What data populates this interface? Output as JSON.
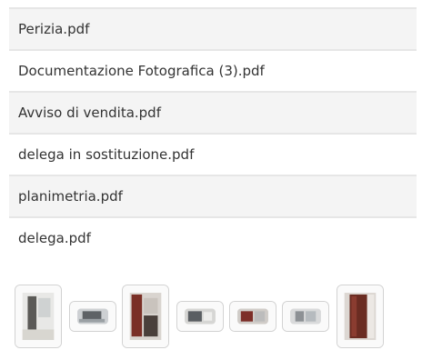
{
  "documents": [
    {
      "label": "Perizia.pdf"
    },
    {
      "label": "Documentazione Fotografica (3).pdf"
    },
    {
      "label": "Avviso di vendita.pdf"
    },
    {
      "label": "delega in sostituzione.pdf"
    },
    {
      "label": "planimetria.pdf"
    },
    {
      "label": "delega.pdf"
    }
  ],
  "gallery": [
    {
      "icon": "photo-thumbnail-icon",
      "orientation": "portrait"
    },
    {
      "icon": "photo-thumbnail-icon",
      "orientation": "landscape"
    },
    {
      "icon": "photo-thumbnail-icon",
      "orientation": "portrait"
    },
    {
      "icon": "photo-thumbnail-icon",
      "orientation": "landscape"
    },
    {
      "icon": "photo-thumbnail-icon",
      "orientation": "landscape"
    },
    {
      "icon": "photo-thumbnail-icon",
      "orientation": "landscape"
    },
    {
      "icon": "photo-thumbnail-icon",
      "orientation": "portrait"
    }
  ]
}
